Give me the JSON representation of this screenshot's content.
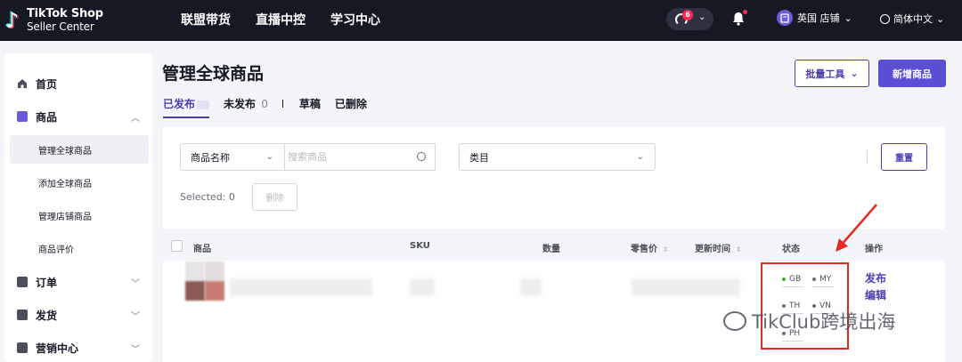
{
  "header": {
    "brand_line1": "TikTok Shop",
    "brand_line2": "Seller Center",
    "nav": [
      "联盟带货",
      "直播中控",
      "学习中心"
    ],
    "support_badge": "6",
    "store_label": "英国 店铺",
    "language": "简体中文"
  },
  "sidebar": {
    "home": "首页",
    "products": "商品",
    "product_subitems": [
      "管理全球商品",
      "添加全球商品",
      "管理店铺商品",
      "商品评价"
    ],
    "orders": "订单",
    "shipping": "发货",
    "marketing": "营销中心"
  },
  "main": {
    "title": "管理全球商品",
    "bulk_tools": "批量工具",
    "add_product": "新增商品",
    "tabs": [
      {
        "label": "已发布",
        "count": ""
      },
      {
        "label": "未发布",
        "count": "0"
      },
      {
        "label": "草稿",
        "count": ""
      },
      {
        "label": "已删除",
        "count": ""
      }
    ],
    "filter": {
      "field_select": "商品名称",
      "search_placeholder": "搜索商品",
      "category_placeholder": "类目",
      "reset": "重置",
      "selected_label": "Selected:",
      "selected_count": "0",
      "delete": "删除"
    },
    "table": {
      "headers": [
        "商品",
        "SKU",
        "数量",
        "零售价",
        "更新时间",
        "状态",
        "操作"
      ],
      "row": {
        "status_regions": [
          "GB",
          "MY",
          "TH",
          "VN",
          "PH"
        ],
        "actions": [
          "发布",
          "编辑"
        ]
      }
    }
  },
  "watermark": "TikClub跨境出海",
  "colors": {
    "topbar": "#161823",
    "accent": "#5b4fd6",
    "highlight_red": "#e8281f"
  }
}
